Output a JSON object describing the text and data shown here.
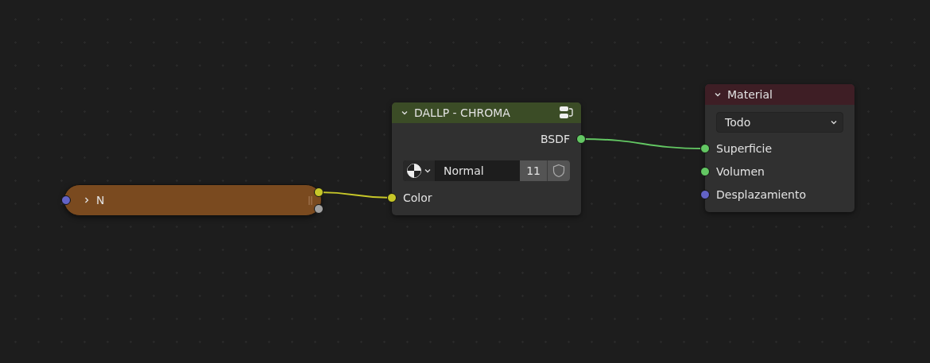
{
  "nodes": [
    {
      "kind": "collapsed",
      "label": "N",
      "color": "#7a4a1f",
      "expanded": false,
      "inputs": [
        {
          "color": "#6363c7"
        }
      ],
      "outputs": [
        {
          "color": "#c7c729"
        },
        {
          "color": "#a1a1a1"
        }
      ]
    },
    {
      "kind": "group",
      "label": "DALLP - CHROMA",
      "color": "#3b4c26",
      "expanded": true,
      "outputs": [
        {
          "label": "BSDF",
          "color": "#63c763"
        }
      ],
      "datablock": {
        "name": "Normal",
        "users": "11"
      },
      "inputs": [
        {
          "label": "Color",
          "color": "#c7c729"
        }
      ]
    },
    {
      "kind": "output",
      "label": "Material",
      "color": "#3e1e25",
      "expanded": true,
      "dropdown": {
        "value": "Todo"
      },
      "inputs": [
        {
          "label": "Superficie",
          "color": "#63c763"
        },
        {
          "label": "Volumen",
          "color": "#63c763"
        },
        {
          "label": "Desplazamiento",
          "color": "#6363c7"
        }
      ]
    }
  ]
}
